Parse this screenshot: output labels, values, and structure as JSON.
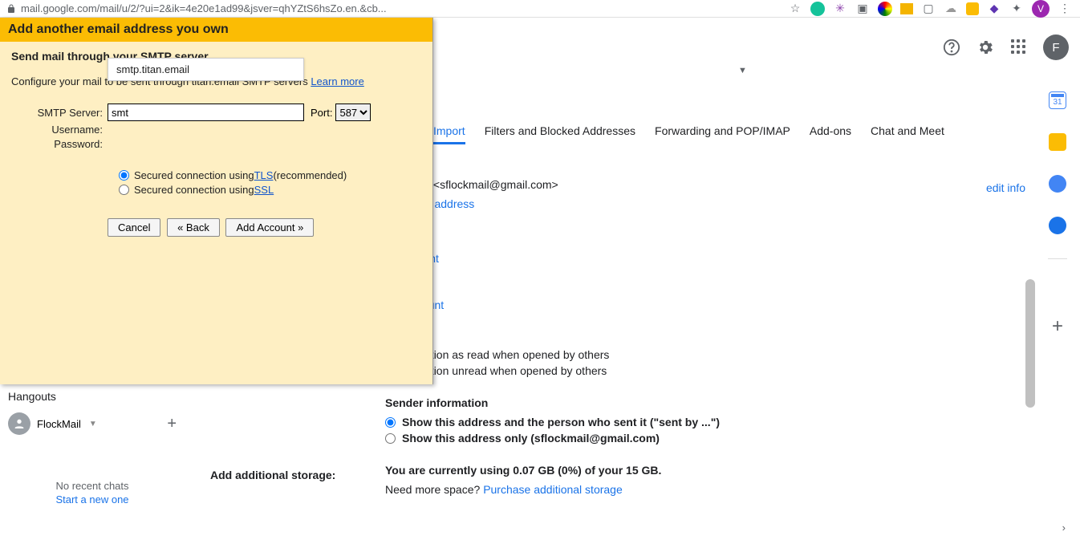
{
  "browser": {
    "url": "mail.google.com/mail/u/2/?ui=2&ik=4e20e1ad99&jsver=qhYZtS6hsZo.en.&cb...",
    "avatar_letter": "V"
  },
  "popup": {
    "title": "Add another email address you own",
    "subtitle": "Send mail through your SMTP server",
    "config_text": "Configure your mail to be sent through titan.email SMTP servers ",
    "learn_more": "Learn more",
    "smtp_label": "SMTP Server:",
    "smtp_value": "smt",
    "port_label": "Port:",
    "port_value": "587",
    "username_label": "Username:",
    "password_label": "Password:",
    "autocomplete": "smtp.titan.email",
    "radio_tls_a": "Secured connection using ",
    "tls": "TLS",
    "recommended": " (recommended)",
    "radio_ssl_a": "Secured connection using ",
    "ssl": "SSL",
    "cancel": "Cancel",
    "back": "« Back",
    "add_account": "Add Account »"
  },
  "gmail": {
    "avatar_letter": "F",
    "tabs": {
      "import": "Import",
      "filters": "Filters and Blocked Addresses",
      "forwarding": "Forwarding and POP/IMAP",
      "addons": "Add-ons",
      "chat": "Chat and Meet"
    },
    "support_line": "l Support <sflockmail@gmail.com>",
    "edit_info": "edit info",
    "another_email": "her email address",
    "mail_account": "ail account",
    "her_account": "her account",
    "read1": "read",
    "read2": "conversation as read when opened by others",
    "read3": "conversation unread when opened by others",
    "sender_info": "Sender information",
    "sender_opt1": "Show this address and the person who sent it (\"sent by ...\")",
    "sender_opt2": "Show this address only (sflockmail@gmail.com)",
    "storage_label": "Add additional storage:",
    "storage_text": "You are currently using 0.07 GB (0%) of your 15 GB.",
    "more_space": "Need more space? ",
    "purchase": "Purchase additional storage"
  },
  "hangouts": {
    "title": "Hangouts",
    "user": "FlockMail",
    "no_chats": "No recent chats",
    "start_new": "Start a new one"
  }
}
